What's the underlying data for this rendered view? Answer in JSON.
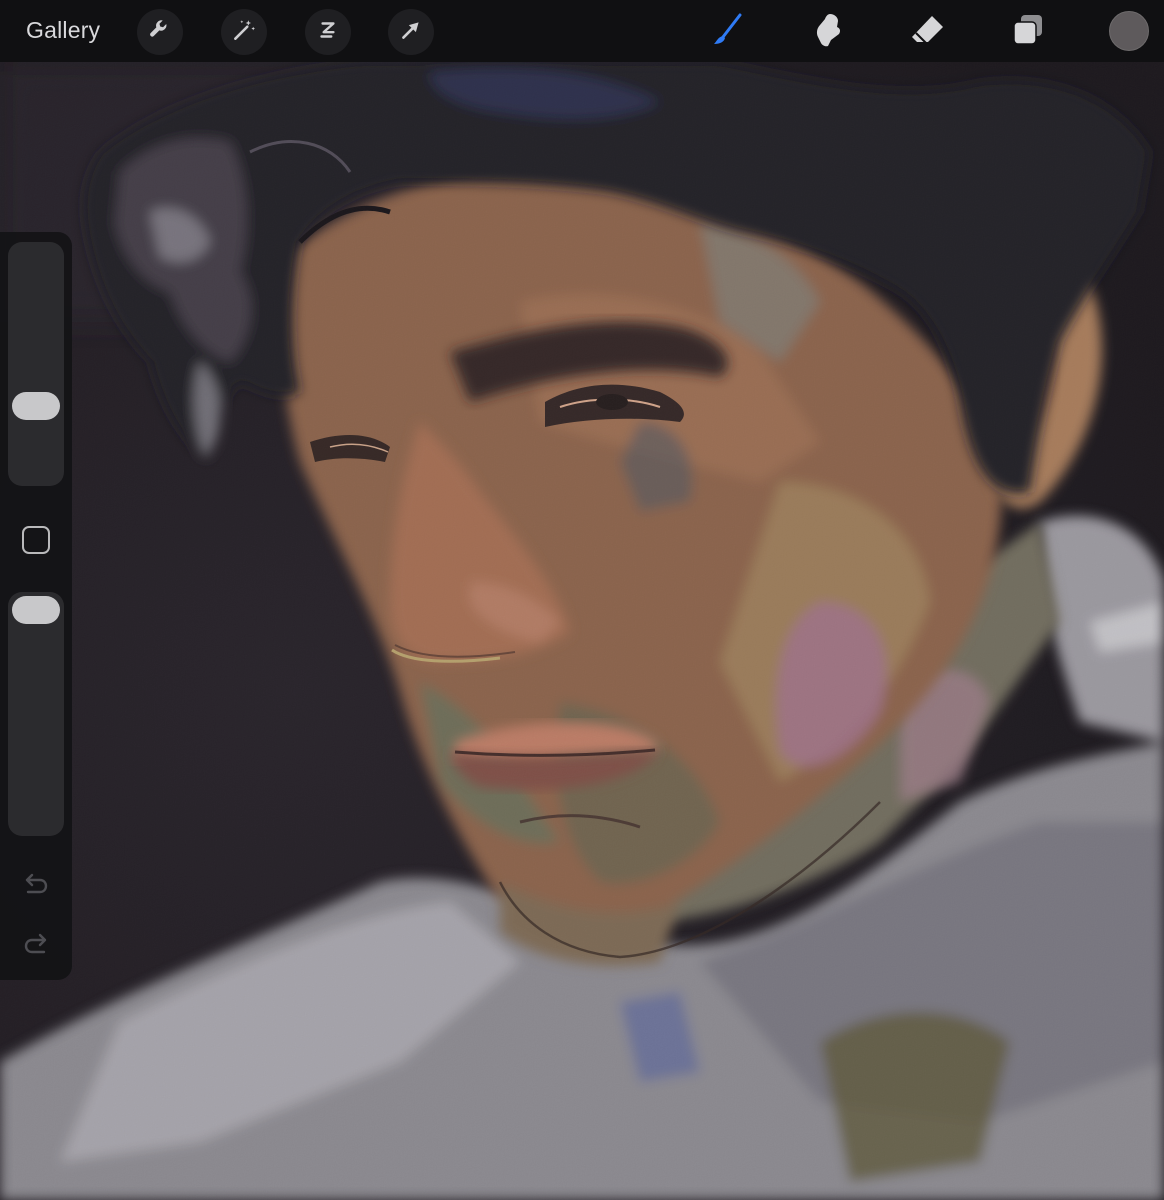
{
  "toolbar": {
    "gallery_label": "Gallery",
    "action_icons": [
      "wrench-icon",
      "magic-wand-icon",
      "selection-icon",
      "transform-arrow-icon"
    ],
    "tool_icons": [
      "brush-icon",
      "smudge-icon",
      "eraser-icon",
      "layers-icon"
    ],
    "active_tool": "brush",
    "active_color": "#5e5a5c",
    "accent_color": "#2f7bf5"
  },
  "sidebar": {
    "brush_size": 0.3,
    "opacity": 0.05,
    "icons": [
      "modify-square-icon",
      "undo-icon",
      "redo-icon"
    ]
  }
}
